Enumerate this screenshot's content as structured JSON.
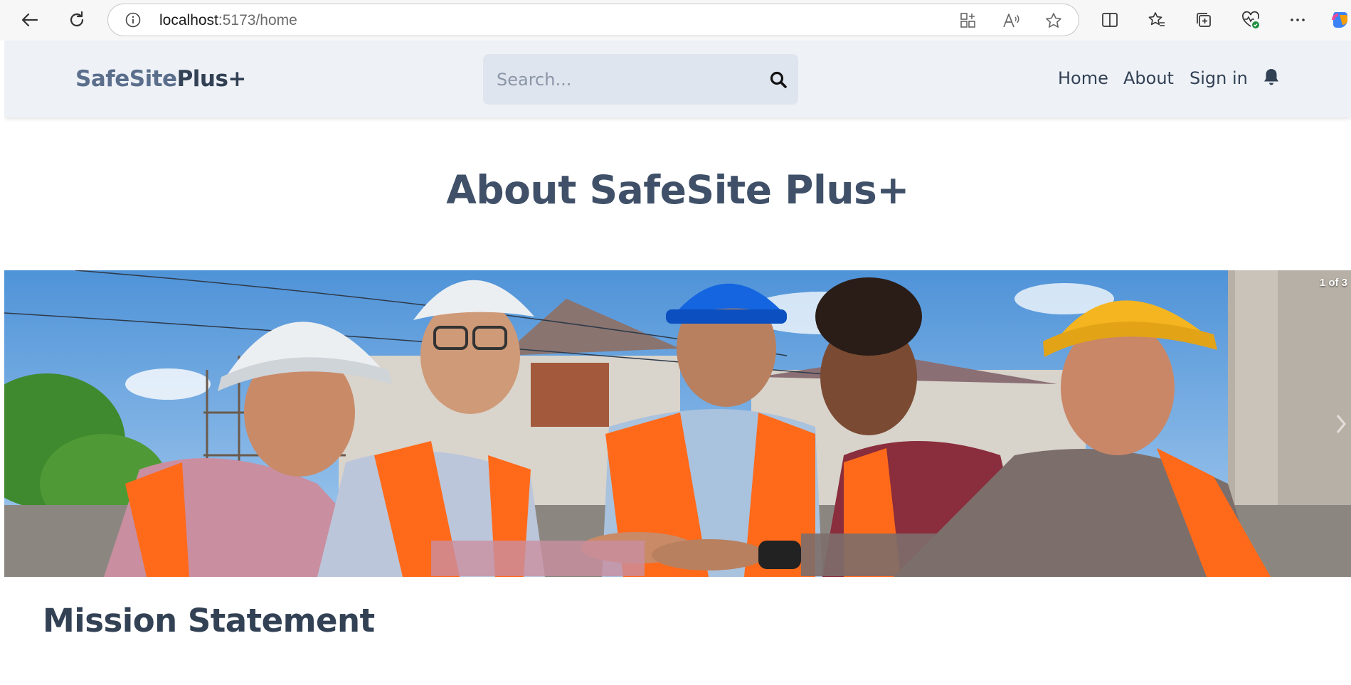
{
  "browser": {
    "url_host": "localhost",
    "url_path": ":5173/home"
  },
  "navbar": {
    "brand_part1": "SafeSite",
    "brand_part2": "Plus+",
    "search_placeholder": "Search...",
    "links": [
      {
        "label": "Home"
      },
      {
        "label": "About"
      },
      {
        "label": "Sign in"
      }
    ]
  },
  "hero": {
    "title": "About SafeSite Plus+"
  },
  "carousel": {
    "counter": "1 of 3"
  },
  "mission": {
    "title": "Mission Statement"
  },
  "colors": {
    "navbar_bg": "#eef2f7",
    "heading": "#3f5068",
    "brand_light": "#5b6f8c",
    "brand_dark": "#334155"
  }
}
